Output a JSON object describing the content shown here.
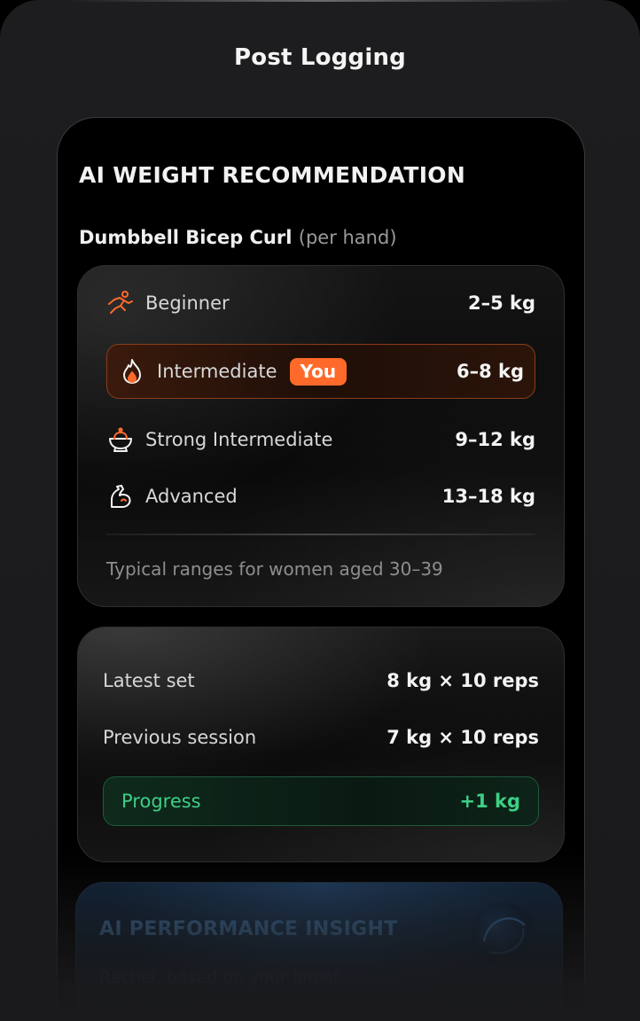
{
  "header": {
    "title": "Post Logging"
  },
  "recommendation": {
    "heading": "AI WEIGHT RECOMMENDATION",
    "exercise": "Dumbbell Bicep Curl",
    "exercise_qualifier": "(per hand)",
    "levels": [
      {
        "name": "Beginner",
        "range": "2–5 kg",
        "icon": "running-person-icon"
      },
      {
        "name": "Intermediate",
        "range": "6–8 kg",
        "icon": "flame-icon",
        "badge": "You",
        "current": true
      },
      {
        "name": "Strong Intermediate",
        "range": "9–12 kg",
        "icon": "bowl-icon"
      },
      {
        "name": "Advanced",
        "range": "13–18 kg",
        "icon": "flexed-arm-icon"
      }
    ],
    "note": "Typical ranges for women aged 30–39",
    "highlight_color": "#ff6a2b"
  },
  "sets": {
    "latest_label": "Latest set",
    "latest_value": "8 kg × 10 reps",
    "previous_label": "Previous session",
    "previous_value": "7 kg × 10 reps",
    "progress_label": "Progress",
    "progress_value": "+1 kg",
    "progress_color": "#3ecf85"
  },
  "insight": {
    "title": "AI PERFORMANCE INSIGHT",
    "text": "Rachel, based on your latest"
  }
}
